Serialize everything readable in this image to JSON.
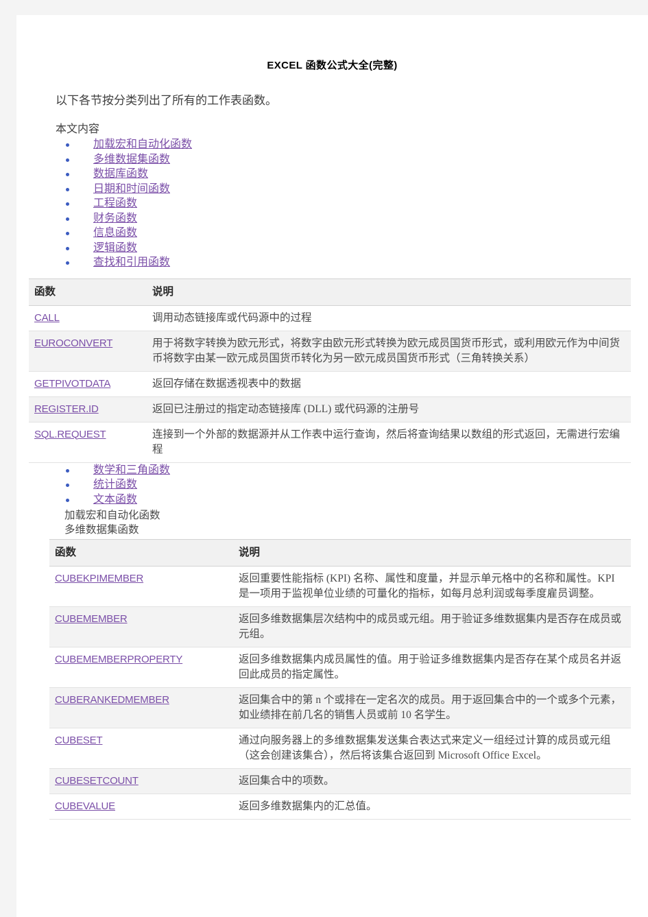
{
  "document": {
    "title": "EXCEL 函数公式大全(完整)",
    "intro": "以下各节按分类列出了所有的工作表函数。",
    "toc_label": "本文内容"
  },
  "toc_top": [
    {
      "label": "加载宏和自动化函数"
    },
    {
      "label": "多维数据集函数"
    },
    {
      "label": "数据库函数"
    },
    {
      "label": "日期和时间函数"
    },
    {
      "label": "工程函数"
    },
    {
      "label": "财务函数"
    },
    {
      "label": "信息函数"
    },
    {
      "label": "逻辑函数"
    },
    {
      "label": "查找和引用函数"
    }
  ],
  "toc_bottom": [
    {
      "label": "数学和三角函数"
    },
    {
      "label": "统计函数"
    },
    {
      "label": "文本函数"
    }
  ],
  "section_lines": [
    {
      "label": "加载宏和自动化函数"
    },
    {
      "label": "多维数据集函数"
    }
  ],
  "table1": {
    "headers": {
      "name": "函数",
      "desc": "说明"
    },
    "rows": [
      {
        "name": "CALL",
        "desc": "调用动态链接库或代码源中的过程"
      },
      {
        "name": "EUROCONVERT",
        "desc": "用于将数字转换为欧元形式，将数字由欧元形式转换为欧元成员国货币形式，或利用欧元作为中间货币将数字由某一欧元成员国货币转化为另一欧元成员国货币形式（三角转换关系）"
      },
      {
        "name": "GETPIVOTDATA",
        "desc": "返回存储在数据透视表中的数据"
      },
      {
        "name": "REGISTER.ID",
        "desc": "返回已注册过的指定动态链接库 (DLL) 或代码源的注册号"
      },
      {
        "name": "SQL.REQUEST",
        "desc": "连接到一个外部的数据源并从工作表中运行查询，然后将查询结果以数组的形式返回，无需进行宏编程"
      }
    ]
  },
  "table2": {
    "headers": {
      "name": "函数",
      "desc": "说明"
    },
    "rows": [
      {
        "name": "CUBEKPIMEMBER",
        "desc": "返回重要性能指标 (KPI) 名称、属性和度量，并显示单元格中的名称和属性。KPI 是一项用于监视单位业绩的可量化的指标，如每月总利润或每季度雇员调整。"
      },
      {
        "name": "CUBEMEMBER",
        "desc": "返回多维数据集层次结构中的成员或元组。用于验证多维数据集内是否存在成员或元组。"
      },
      {
        "name": "CUBEMEMBERPROPERTY",
        "desc": "返回多维数据集内成员属性的值。用于验证多维数据集内是否存在某个成员名并返回此成员的指定属性。"
      },
      {
        "name": "CUBERANKEDMEMBER",
        "desc": "返回集合中的第 n 个或排在一定名次的成员。用于返回集合中的一个或多个元素，如业绩排在前几名的销售人员或前 10 名学生。"
      },
      {
        "name": "CUBESET",
        "desc": "通过向服务器上的多维数据集发送集合表达式来定义一组经过计算的成员或元组（这会创建该集合），然后将该集合返回到 Microsoft Office Excel。"
      },
      {
        "name": "CUBESETCOUNT",
        "desc": "返回集合中的项数。"
      },
      {
        "name": "CUBEVALUE",
        "desc": "返回多维数据集内的汇总值。"
      }
    ]
  },
  "colors": {
    "link": "#7b4fa8",
    "bullet": "#3b5bc0",
    "header_row_bg": "#f1f1f1",
    "stripe_bg": "#f3f3f3",
    "page_bg": "#ffffff",
    "canvas_bg": "#f4f4f4"
  }
}
